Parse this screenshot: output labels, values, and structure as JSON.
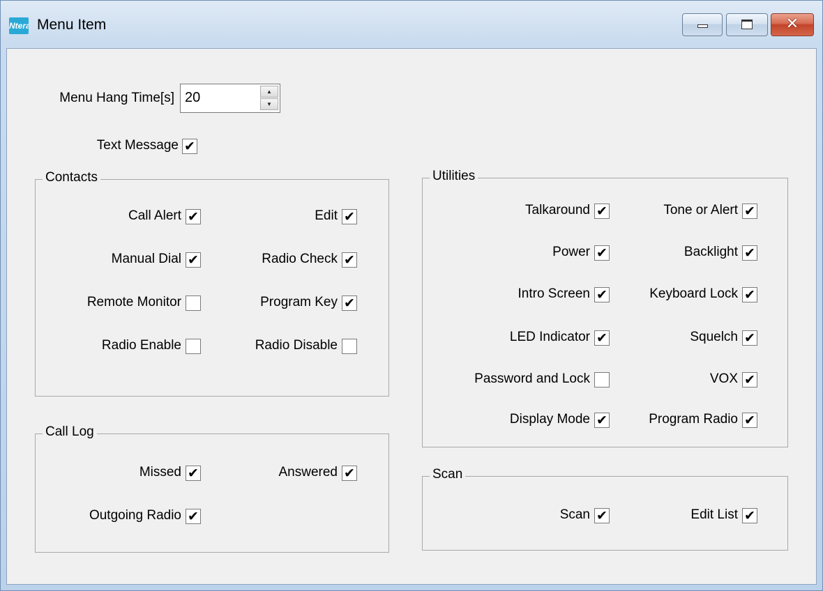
{
  "window": {
    "title": "Menu Item",
    "icon_name": "app-logo-icon",
    "icon_text": "Ntera"
  },
  "menu_hang_time": {
    "label": "Menu Hang Time[s]",
    "value": "20"
  },
  "text_message": {
    "label": "Text Message",
    "checked": true
  },
  "groups": {
    "contacts": {
      "title": "Contacts",
      "items": [
        {
          "label": "Call Alert",
          "checked": true
        },
        {
          "label": "Edit",
          "checked": true
        },
        {
          "label": "Manual Dial",
          "checked": true
        },
        {
          "label": "Radio Check",
          "checked": true
        },
        {
          "label": "Remote Monitor",
          "checked": false
        },
        {
          "label": "Program Key",
          "checked": true
        },
        {
          "label": "Radio Enable",
          "checked": false
        },
        {
          "label": "Radio Disable",
          "checked": false
        }
      ]
    },
    "call_log": {
      "title": "Call Log",
      "items": [
        {
          "label": "Missed",
          "checked": true
        },
        {
          "label": "Answered",
          "checked": true
        },
        {
          "label": "Outgoing Radio",
          "checked": true
        }
      ]
    },
    "utilities": {
      "title": "Utilities",
      "items": [
        {
          "label": "Talkaround",
          "checked": true
        },
        {
          "label": "Tone or Alert",
          "checked": true
        },
        {
          "label": "Power",
          "checked": true
        },
        {
          "label": "Backlight",
          "checked": true
        },
        {
          "label": "Intro Screen",
          "checked": true
        },
        {
          "label": "Keyboard Lock",
          "checked": true
        },
        {
          "label": "LED Indicator",
          "checked": true
        },
        {
          "label": "Squelch",
          "checked": true
        },
        {
          "label": "Password and Lock",
          "checked": false
        },
        {
          "label": "VOX",
          "checked": true
        },
        {
          "label": "Display Mode",
          "checked": true
        },
        {
          "label": "Program Radio",
          "checked": true
        }
      ]
    },
    "scan": {
      "title": "Scan",
      "items": [
        {
          "label": "Scan",
          "checked": true
        },
        {
          "label": "Edit List",
          "checked": true
        }
      ]
    }
  },
  "colors": {
    "title_bar": "#c9dbee",
    "client_bg": "#f0f0f0",
    "close_button": "#c2442a"
  }
}
